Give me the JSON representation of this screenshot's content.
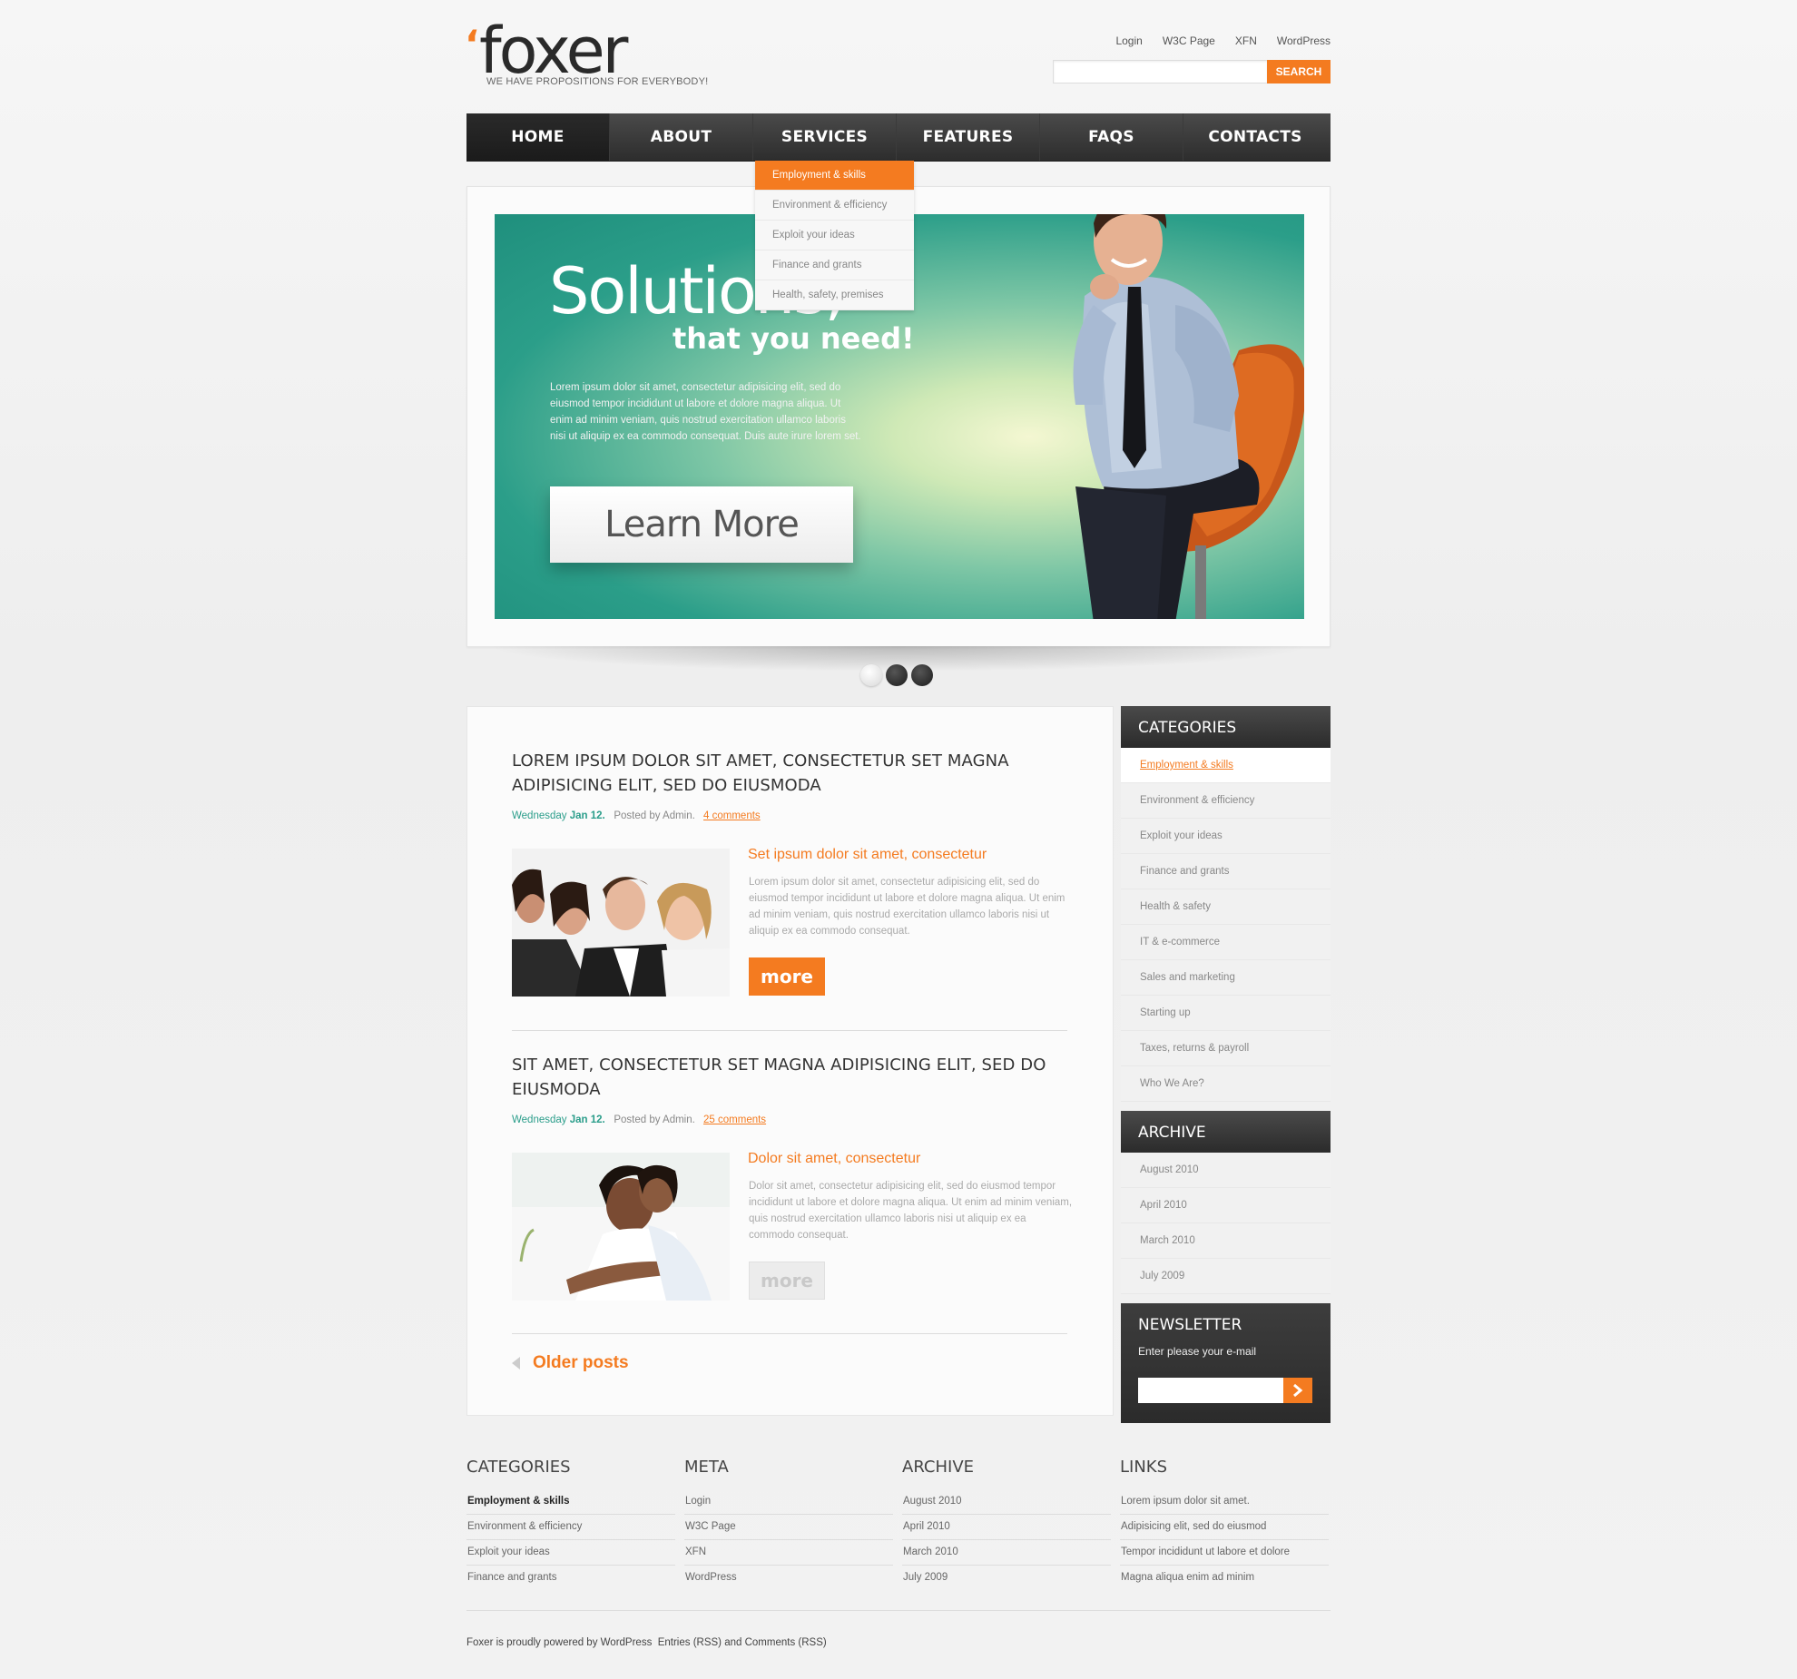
{
  "brand": {
    "mark": "‘",
    "name": "foxer",
    "slogan": "WE HAVE PROPOSITIONS FOR EVERYBODY!"
  },
  "top_links": [
    "Login",
    "W3C Page",
    "XFN",
    "WordPress"
  ],
  "search": {
    "placeholder": "",
    "button": "SEARCH"
  },
  "nav": [
    {
      "label": "HOME",
      "active": true
    },
    {
      "label": "ABOUT"
    },
    {
      "label": "SERVICES"
    },
    {
      "label": "FEATURES"
    },
    {
      "label": "FAQS"
    },
    {
      "label": "CONTACTS"
    }
  ],
  "services_menu": [
    "Employment & skills",
    "Environment & efficiency",
    "Exploit your ideas",
    "Finance and grants",
    "Health, safety, premises"
  ],
  "slide": {
    "headline": "Solutions,",
    "subheadline": "that you need!",
    "text": "Lorem ipsum dolor sit amet, consectetur adipisicing elit, sed do eiusmod tempor incididunt ut labore et dolore magna aliqua. Ut enim ad minim veniam, quis nostrud exercitation ullamco laboris nisi ut aliquip ex ea commodo consequat. Duis aute irure lorem set.",
    "button": "Learn More",
    "active_dot": 1,
    "dot_count": 3
  },
  "posts": [
    {
      "title": "LOREM IPSUM DOLOR SIT AMET, CONSECTETUR SET MAGNA ADIPISICING ELIT, SED DO EIUSMODA",
      "day": "Wednesday",
      "date": "Jan 12.",
      "posted": "Posted by Admin.",
      "comments": "4 comments",
      "subtitle": "Set ipsum dolor sit amet, consectetur",
      "excerpt": "Lorem ipsum dolor sit amet, consectetur adipisicing elit, sed do eiusmod tempor incididunt ut labore et dolore magna aliqua. Ut enim ad minim veniam, quis nostrud exercitation ullamco laboris nisi ut aliquip ex ea commodo consequat.",
      "more": "more"
    },
    {
      "title": "SIT AMET, CONSECTETUR SET MAGNA ADIPISICING ELIT, SED DO EIUSMODA",
      "day": "Wednesday",
      "date": "Jan 12.",
      "posted": "Posted by Admin.",
      "comments": "25 comments",
      "subtitle": "Dolor sit amet, consectetur",
      "excerpt": "Dolor sit amet, consectetur adipisicing elit, sed do eiusmod tempor incididunt ut labore et dolore magna aliqua. Ut enim ad minim veniam, quis nostrud exercitation ullamco laboris nisi ut aliquip ex ea commodo consequat.",
      "more": "more"
    }
  ],
  "older_posts": "Older posts",
  "sidebar": {
    "categories": {
      "title": "CATEGORIES",
      "items": [
        "Employment & skills",
        "Environment & efficiency",
        "Exploit your ideas",
        "Finance and grants",
        "Health & safety",
        "IT & e-commerce",
        "Sales and marketing",
        "Starting up",
        "Taxes, returns & payroll",
        "Who We Are?"
      ]
    },
    "archive": {
      "title": "ARCHIVE",
      "items": [
        "August 2010",
        "April 2010",
        "March 2010",
        "July 2009"
      ]
    },
    "newsletter": {
      "title": "NEWSLETTER",
      "label": "Enter please your e-mail",
      "placeholder": ""
    }
  },
  "footer": {
    "columns": [
      {
        "title": "CATEGORIES",
        "items": [
          "Employment & skills",
          "Environment & efficiency",
          "Exploit your ideas",
          "Finance and grants"
        ]
      },
      {
        "title": "META",
        "items": [
          "Login",
          "W3C Page",
          "XFN",
          "WordPress"
        ]
      },
      {
        "title": "ARCHIVE",
        "items": [
          "August 2010",
          "April 2010",
          "March 2010",
          "July 2009"
        ]
      },
      {
        "title": "LINKS",
        "items": [
          "Lorem ipsum dolor sit amet.",
          "Adipisicing elit, sed do eiusmod",
          "Tempor incididunt ut labore et dolore",
          "Magna aliqua  enim ad minim"
        ]
      }
    ],
    "copyright": "Foxer is proudly powered by WordPress",
    "entries_rss": "Entries (RSS)",
    "and": "and",
    "comments_rss": "Comments (RSS)"
  },
  "colors": {
    "accent": "#f47b20",
    "teal": "#2a9d8a",
    "dark": "#2d2d2d"
  }
}
